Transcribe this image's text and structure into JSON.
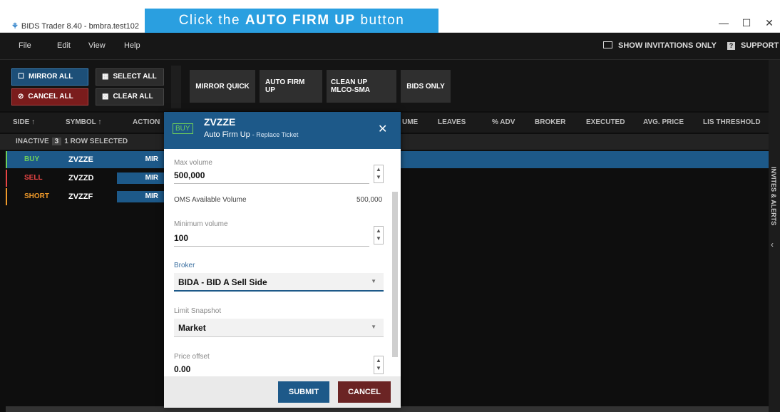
{
  "window": {
    "title": "BIDS Trader 8.40 - bmbra.test102",
    "logo_glyph": "⚘"
  },
  "menu": {
    "items": [
      "File",
      "Edit",
      "View",
      "Help"
    ],
    "show_invitations": "SHOW INVITATIONS ONLY",
    "support": "SUPPORT"
  },
  "toolbar": {
    "mirror_all": "MIRROR ALL",
    "select_all": "SELECT ALL",
    "cancel_all": "CANCEL ALL",
    "clear_all": "CLEAR ALL",
    "mirror_quick": "MIRROR QUICK",
    "auto_firm_up": "AUTO FIRM UP",
    "clean_up_1": "CLEAN UP",
    "clean_up_2": "MLCO-SMA",
    "bids_only": "BIDS ONLY"
  },
  "columns": {
    "side": "SIDE",
    "symbol": "SYMBOL",
    "action": "ACTION",
    "volume": "UME",
    "leaves": "LEAVES",
    "adv": "% ADV",
    "broker": "BROKER",
    "executed": "EXECUTED",
    "avg_price": "AVG. PRICE",
    "lis": "LIS THRESHOLD"
  },
  "status": {
    "label": "INACTIVE",
    "count": "3",
    "selected": "1 ROW SELECTED"
  },
  "rows": [
    {
      "side": "BUY",
      "symbol": "ZVZZE",
      "action": "MIR",
      "color": "#6fcf5a"
    },
    {
      "side": "SELL",
      "symbol": "ZVZZD",
      "action": "MIR",
      "color": "#e84545"
    },
    {
      "side": "SHORT",
      "symbol": "ZVZZF",
      "action": "MIR",
      "color": "#f09a2a"
    }
  ],
  "side_panel": {
    "label": "INVITES & ALERTS"
  },
  "callout": {
    "prefix": "Click the ",
    "bold": "AUTO FIRM UP",
    "suffix": " button"
  },
  "modal": {
    "side_badge": "BUY",
    "symbol": "ZVZZE",
    "title": "Auto Firm Up",
    "subtitle": "- Replace Ticket",
    "max_volume_label": "Max volume",
    "max_volume": "500,000",
    "oms_label": "OMS Available Volume",
    "oms_value": "500,000",
    "min_volume_label": "Minimum volume",
    "min_volume": "100",
    "broker_label": "Broker",
    "broker_value": "BIDA - BID A Sell Side",
    "limit_label": "Limit Snapshot",
    "limit_value": "Market",
    "price_offset_label": "Price offset",
    "price_offset": "0.00",
    "submit": "SUBMIT",
    "cancel": "CANCEL"
  },
  "colors": {
    "accent": "#1d5989",
    "callout": "#2a9fe0",
    "buy": "#6fcf5a",
    "sell": "#e84545",
    "short": "#f09a2a"
  }
}
